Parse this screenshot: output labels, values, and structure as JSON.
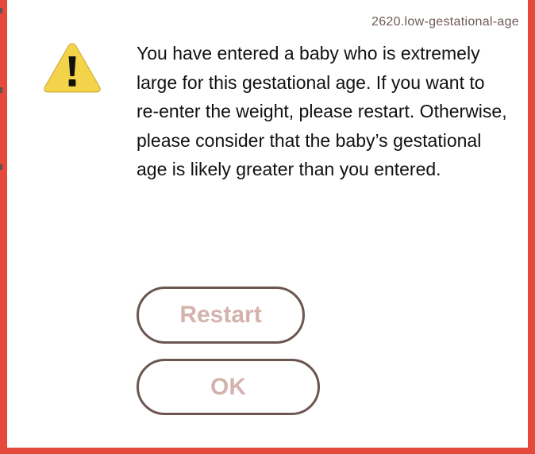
{
  "dialog": {
    "id_label": "2620.low-gestational-age",
    "message": "You have entered a baby who is extremely large for this gestational age. If you want to re-enter the weight, please restart. Otherwise, please consider that the baby’s gestational age is likely greater than you entered.",
    "icon": "warning-icon",
    "buttons": {
      "restart_label": "Restart",
      "ok_label": "OK"
    }
  },
  "colors": {
    "frame": "#e5493a",
    "background": "#ffffff",
    "warning_fill": "#f3d34a",
    "button_border": "#6b5650",
    "button_text": "#d4b2ad"
  }
}
